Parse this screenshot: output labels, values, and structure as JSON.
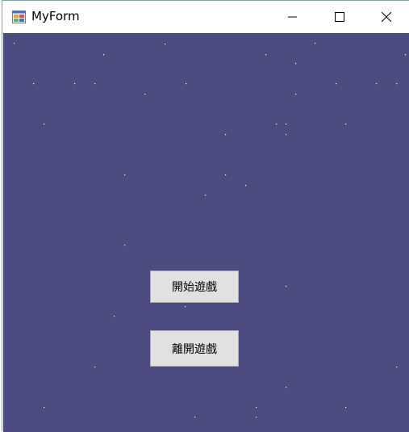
{
  "window": {
    "title": "MyForm"
  },
  "buttons": {
    "start": "開始遊戲",
    "exit": "離開遊戲"
  },
  "colors": {
    "background": "#4d4c80",
    "star": "#ffffff",
    "button_face": "#e1e1e1"
  },
  "icons": {
    "app": "app-form-icon",
    "minimize": "minimize-icon",
    "maximize": "maximize-icon",
    "close": "close-icon"
  }
}
